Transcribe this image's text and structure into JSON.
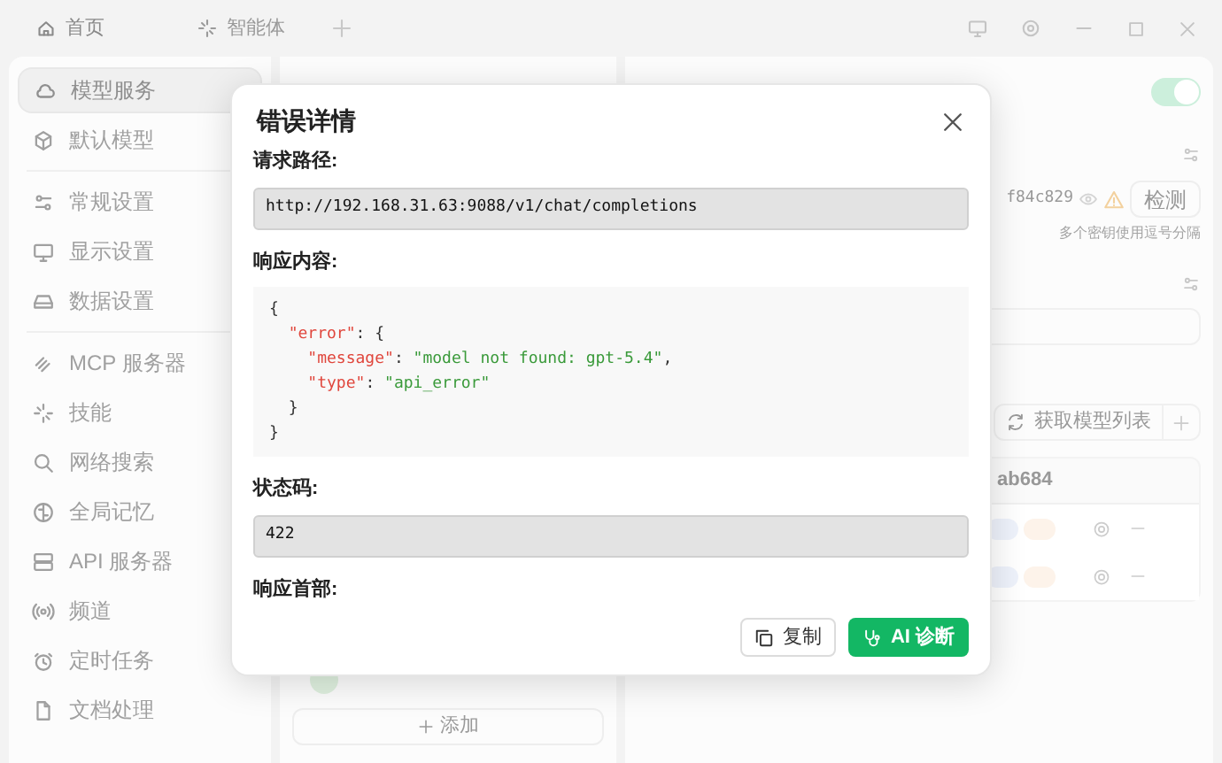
{
  "tabs": [
    {
      "label": "首页",
      "selected": true
    },
    {
      "label": "智能体",
      "selected": false
    }
  ],
  "sidebar": {
    "groups": [
      [
        {
          "label": "模型服务",
          "selected": true
        },
        {
          "label": "默认模型",
          "selected": false
        }
      ],
      [
        {
          "label": "常规设置",
          "selected": false
        },
        {
          "label": "显示设置",
          "selected": false
        },
        {
          "label": "数据设置",
          "selected": false
        }
      ],
      [
        {
          "label": "MCP 服务器",
          "selected": false
        },
        {
          "label": "技能",
          "selected": false
        },
        {
          "label": "网络搜索",
          "selected": false
        },
        {
          "label": "全局记忆",
          "selected": false
        },
        {
          "label": "API 服务器",
          "selected": false
        },
        {
          "label": "频道",
          "selected": false
        },
        {
          "label": "定时任务",
          "selected": false
        },
        {
          "label": "文档处理",
          "selected": false
        }
      ]
    ]
  },
  "provider_list": {
    "add_button": "添加"
  },
  "provider_detail": {
    "enabled": true,
    "api_key": "f84c829",
    "check_button": "检测",
    "api_key_hint": "多个密钥使用逗号分隔",
    "fetch_models_button": "获取模型列表",
    "model_group": "ab684"
  },
  "dialog": {
    "title": "错误详情",
    "sections": [
      {
        "kind": "box",
        "label": "请求路径:",
        "value": "http://192.168.31.63:9088/v1/chat/completions"
      },
      {
        "kind": "code",
        "label": "响应内容:",
        "lines": [
          [
            {
              "kind": "punct",
              "text": "{"
            }
          ],
          [
            {
              "kind": "key",
              "text": "  \"error\""
            },
            {
              "kind": "punct",
              "text": ": {"
            }
          ],
          [
            {
              "kind": "key",
              "text": "    \"message\""
            },
            {
              "kind": "punct",
              "text": ": "
            },
            {
              "kind": "string",
              "text": "\"model not found: gpt-5.4\""
            },
            {
              "kind": "punct",
              "text": ","
            }
          ],
          [
            {
              "kind": "key",
              "text": "    \"type\""
            },
            {
              "kind": "punct",
              "text": ": "
            },
            {
              "kind": "string",
              "text": "\"api_error\""
            }
          ],
          [
            {
              "kind": "punct",
              "text": "  }"
            }
          ],
          [
            {
              "kind": "punct",
              "text": "}"
            }
          ]
        ]
      },
      {
        "kind": "box",
        "label": "状态码:",
        "value": "422"
      },
      {
        "kind": "label",
        "label": "响应首部:"
      }
    ],
    "buttons": [
      {
        "label": "复制",
        "kind": "copy"
      },
      {
        "label": "AI 诊断",
        "kind": "primary"
      }
    ]
  }
}
